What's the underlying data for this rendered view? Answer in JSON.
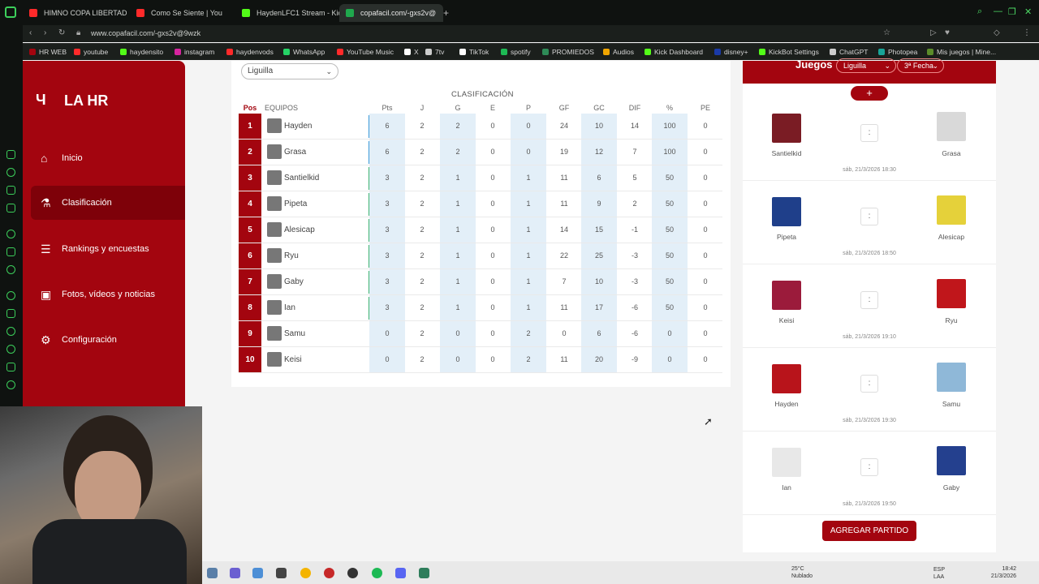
{
  "browser": {
    "tabs": [
      {
        "label": "HIMNO COPA LIBERTADOR",
        "color": "#ff2a2a"
      },
      {
        "label": "Como Se Siente | You",
        "color": "#ff2a2a"
      },
      {
        "label": "HaydenLFC1 Stream - Kic",
        "color": "#53fc18"
      },
      {
        "label": "copafacil.com/-gxs2v@",
        "color": "#1fa84d"
      }
    ],
    "url": "www.copafacil.com/-gxs2v@9wzk",
    "bookmarks": [
      {
        "label": "HR WEB",
        "color": "#a3050f"
      },
      {
        "label": "youtube",
        "color": "#ff2a2a"
      },
      {
        "label": "haydensito",
        "color": "#53fc18"
      },
      {
        "label": "instagram",
        "color": "#d6249f"
      },
      {
        "label": "haydenvods",
        "color": "#ff2a2a"
      },
      {
        "label": "WhatsApp",
        "color": "#25d366"
      },
      {
        "label": "YouTube Music",
        "color": "#ff2a2a"
      },
      {
        "label": "X",
        "color": "#ffffff"
      },
      {
        "label": "7tv",
        "color": "#cccccc"
      },
      {
        "label": "TikTok",
        "color": "#ffffff"
      },
      {
        "label": "spotify",
        "color": "#1db954"
      },
      {
        "label": "PROMIEDOS",
        "color": "#2e8b57"
      },
      {
        "label": "Audios",
        "color": "#f0a500"
      },
      {
        "label": "Kick Dashboard",
        "color": "#53fc18"
      },
      {
        "label": "disney+",
        "color": "#1a3aa8"
      },
      {
        "label": "KickBot Settings",
        "color": "#53fc18"
      },
      {
        "label": "ChatGPT",
        "color": "#cccccc"
      },
      {
        "label": "Photopea",
        "color": "#18a497"
      },
      {
        "label": "Mis juegos | Mine...",
        "color": "#5b8c2a"
      }
    ]
  },
  "sidebar": {
    "brand": "LA HR",
    "items": [
      {
        "label": "Inicio",
        "icon": "home-icon"
      },
      {
        "label": "Clasificación",
        "icon": "trophy-icon"
      },
      {
        "label": "Rankings y encuestas",
        "icon": "chart-icon"
      },
      {
        "label": "Fotos, vídeos y noticias",
        "icon": "media-icon"
      },
      {
        "label": "Configuración",
        "icon": "gear-icon"
      }
    ]
  },
  "main": {
    "phase_select": "Liguilla",
    "table_title": "CLASIFICACIÓN",
    "headers": [
      "Pos",
      "EQUIPOS",
      "Pts",
      "J",
      "G",
      "E",
      "P",
      "GF",
      "GC",
      "DIF",
      "%",
      "PE"
    ],
    "rows": [
      {
        "pos": "1",
        "team": "Hayden",
        "pts": "6",
        "j": "2",
        "g": "2",
        "e": "0",
        "p": "0",
        "gf": "24",
        "gc": "10",
        "dif": "14",
        "pct": "100",
        "pe": "0",
        "bar": "#3b9ad9"
      },
      {
        "pos": "2",
        "team": "Grasa",
        "pts": "6",
        "j": "2",
        "g": "2",
        "e": "0",
        "p": "0",
        "gf": "19",
        "gc": "12",
        "dif": "7",
        "pct": "100",
        "pe": "0",
        "bar": "#3b9ad9"
      },
      {
        "pos": "3",
        "team": "Santielkid",
        "pts": "3",
        "j": "2",
        "g": "1",
        "e": "0",
        "p": "1",
        "gf": "11",
        "gc": "6",
        "dif": "5",
        "pct": "50",
        "pe": "0",
        "bar": "#3cb371"
      },
      {
        "pos": "4",
        "team": "Pipeta",
        "pts": "3",
        "j": "2",
        "g": "1",
        "e": "0",
        "p": "1",
        "gf": "11",
        "gc": "9",
        "dif": "2",
        "pct": "50",
        "pe": "0",
        "bar": "#3cb371"
      },
      {
        "pos": "5",
        "team": "Alesicap",
        "pts": "3",
        "j": "2",
        "g": "1",
        "e": "0",
        "p": "1",
        "gf": "14",
        "gc": "15",
        "dif": "-1",
        "pct": "50",
        "pe": "0",
        "bar": "#3cb371"
      },
      {
        "pos": "6",
        "team": "Ryu",
        "pts": "3",
        "j": "2",
        "g": "1",
        "e": "0",
        "p": "1",
        "gf": "22",
        "gc": "25",
        "dif": "-3",
        "pct": "50",
        "pe": "0",
        "bar": "#3cb371"
      },
      {
        "pos": "7",
        "team": "Gaby",
        "pts": "3",
        "j": "2",
        "g": "1",
        "e": "0",
        "p": "1",
        "gf": "7",
        "gc": "10",
        "dif": "-3",
        "pct": "50",
        "pe": "0",
        "bar": "#3cb371"
      },
      {
        "pos": "8",
        "team": "Ian",
        "pts": "3",
        "j": "2",
        "g": "1",
        "e": "0",
        "p": "1",
        "gf": "11",
        "gc": "17",
        "dif": "-6",
        "pct": "50",
        "pe": "0",
        "bar": "#3cb371"
      },
      {
        "pos": "9",
        "team": "Samu",
        "pts": "0",
        "j": "2",
        "g": "0",
        "e": "0",
        "p": "2",
        "gf": "0",
        "gc": "6",
        "dif": "-6",
        "pct": "0",
        "pe": "0",
        "bar": "transparent"
      },
      {
        "pos": "10",
        "team": "Keisi",
        "pts": "0",
        "j": "2",
        "g": "0",
        "e": "0",
        "p": "2",
        "gf": "11",
        "gc": "20",
        "dif": "-9",
        "pct": "0",
        "pe": "0",
        "bar": "transparent"
      }
    ]
  },
  "games": {
    "title": "Juegos",
    "phase": "Liguilla",
    "round": "3ª Fecha",
    "add_label": "+",
    "add_match_label": "AGREGAR PARTIDO",
    "score_placeholder": ":",
    "matches": [
      {
        "home": "Santielkid",
        "away": "Grasa",
        "date": "sáb, 21/3/2026 18:30",
        "home_color": "#7a1c24",
        "away_color": "#d9d9d9"
      },
      {
        "home": "Pipeta",
        "away": "Alesicap",
        "date": "sáb, 21/3/2026 18:50",
        "home_color": "#1f3f8a",
        "away_color": "#e5d13a"
      },
      {
        "home": "Keisi",
        "away": "Ryu",
        "date": "sáb, 21/3/2026 19:10",
        "home_color": "#9b1b3b",
        "away_color": "#c0161b"
      },
      {
        "home": "Hayden",
        "away": "Samu",
        "date": "sáb, 21/3/2026 19:30",
        "home_color": "#b8141b",
        "away_color": "#8fb8d8"
      },
      {
        "home": "Ian",
        "away": "Gaby",
        "date": "sáb, 21/3/2026 19:50",
        "home_color": "#e8e8e8",
        "away_color": "#24408e"
      }
    ]
  },
  "taskbar": {
    "weather_temp": "25°C",
    "weather_desc": "Nublado",
    "lang_1": "ESP",
    "lang_2": "LAA",
    "time": "18:42",
    "date": "21/3/2026"
  }
}
